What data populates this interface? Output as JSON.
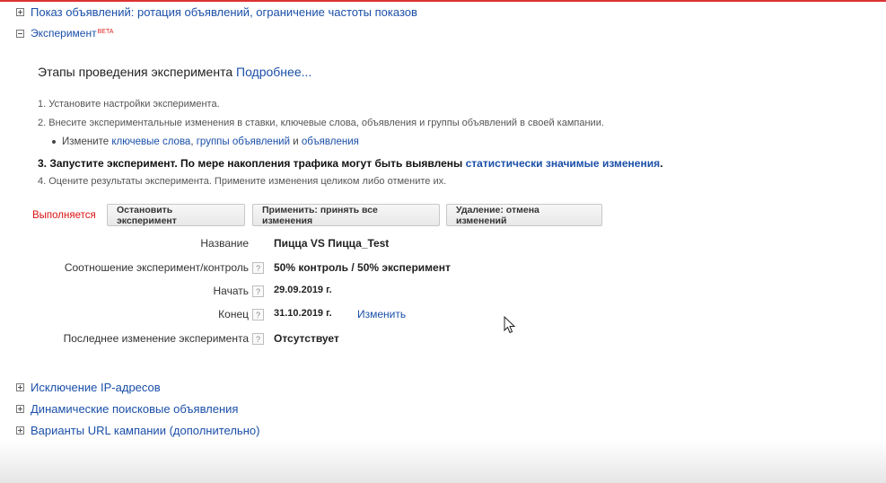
{
  "sections": {
    "ad_delivery": "Показ объявлений: ротация объявлений, ограничение частоты показов",
    "experiment": "Эксперимент",
    "experiment_badge": "BETA",
    "ip_exclusion": "Исключение IP-адресов",
    "dynamic_search_ads": "Динамические поисковые объявления",
    "url_options": "Варианты URL кампании (дополнительно)"
  },
  "experiment": {
    "steps_heading": "Этапы проведения эксперимента",
    "learn_more": "Подробнее...",
    "step1": "1. Установите настройки эксперимента.",
    "step2": "2. Внесите экспериментальные изменения в ставки, ключевые слова, объявления и группы объявлений в своей кампании.",
    "bullet_prefix": "Измените",
    "bullet_link_keywords": "ключевые слова",
    "bullet_comma": ",",
    "bullet_link_adgroups": "группы объявлений",
    "bullet_and": "и",
    "bullet_link_ads": "объявления",
    "step3_text": "3. Запустите эксперимент. По мере накопления трафика могут быть выявлены",
    "step3_link": "статистически значимые изменения",
    "step3_end": ".",
    "step4": "4. Оцените результаты эксперимента. Примените изменения целиком либо отмените их.",
    "status": "Выполняется",
    "status_color": "#dd1111",
    "buttons": {
      "stop": "Остановить эксперимент",
      "apply": "Применить: принять все изменения",
      "delete": "Удаление: отмена изменений"
    },
    "fields": {
      "name_label": "Название",
      "name_value": "Пицца VS Пицца_Test",
      "split_label": "Соотношение эксперимент/контроль",
      "split_value": "50% контроль / 50% эксперимент",
      "start_label": "Начать",
      "start_value": "29.09.2019 г.",
      "end_label": "Конец",
      "end_value": "31.10.2019 г.",
      "end_change": "Изменить",
      "last_change_label": "Последнее изменение эксперимента",
      "last_change_value": "Отсутствует"
    },
    "help_glyph": "?"
  },
  "colors": {
    "link": "#1a4fa8",
    "accent_line": "#dd3333"
  }
}
